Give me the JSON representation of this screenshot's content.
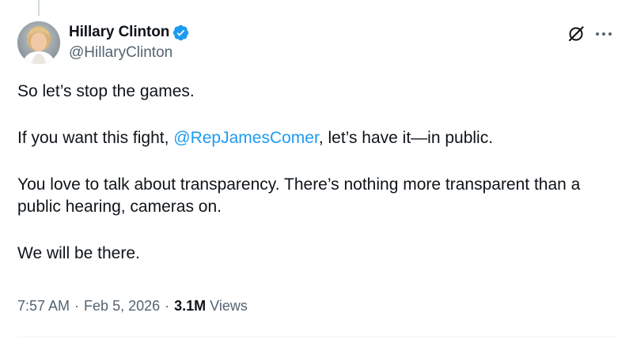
{
  "author": {
    "display_name": "Hillary Clinton",
    "handle": "@HillaryClinton",
    "verified": true
  },
  "tweet": {
    "line1": "So let’s stop the games.",
    "line2_before": "If you want this fight, ",
    "line2_mention": "@RepJamesComer",
    "line2_after": ", let’s have it—in public.",
    "line3": "You love to talk about transparency. There’s nothing more transparent than a public hearing, cameras on.",
    "line4": "We will be there."
  },
  "meta": {
    "time": "7:57 AM",
    "separator1": "·",
    "date": "Feb 5, 2026",
    "separator2": "·",
    "views_count": "3.1M",
    "views_label": "Views"
  },
  "colors": {
    "accent": "#1d9bf0",
    "text": "#0f1419",
    "secondary": "#536471"
  },
  "icons": {
    "verified": "verified-badge-icon",
    "grok": "grok-icon",
    "more": "more-options-icon"
  }
}
